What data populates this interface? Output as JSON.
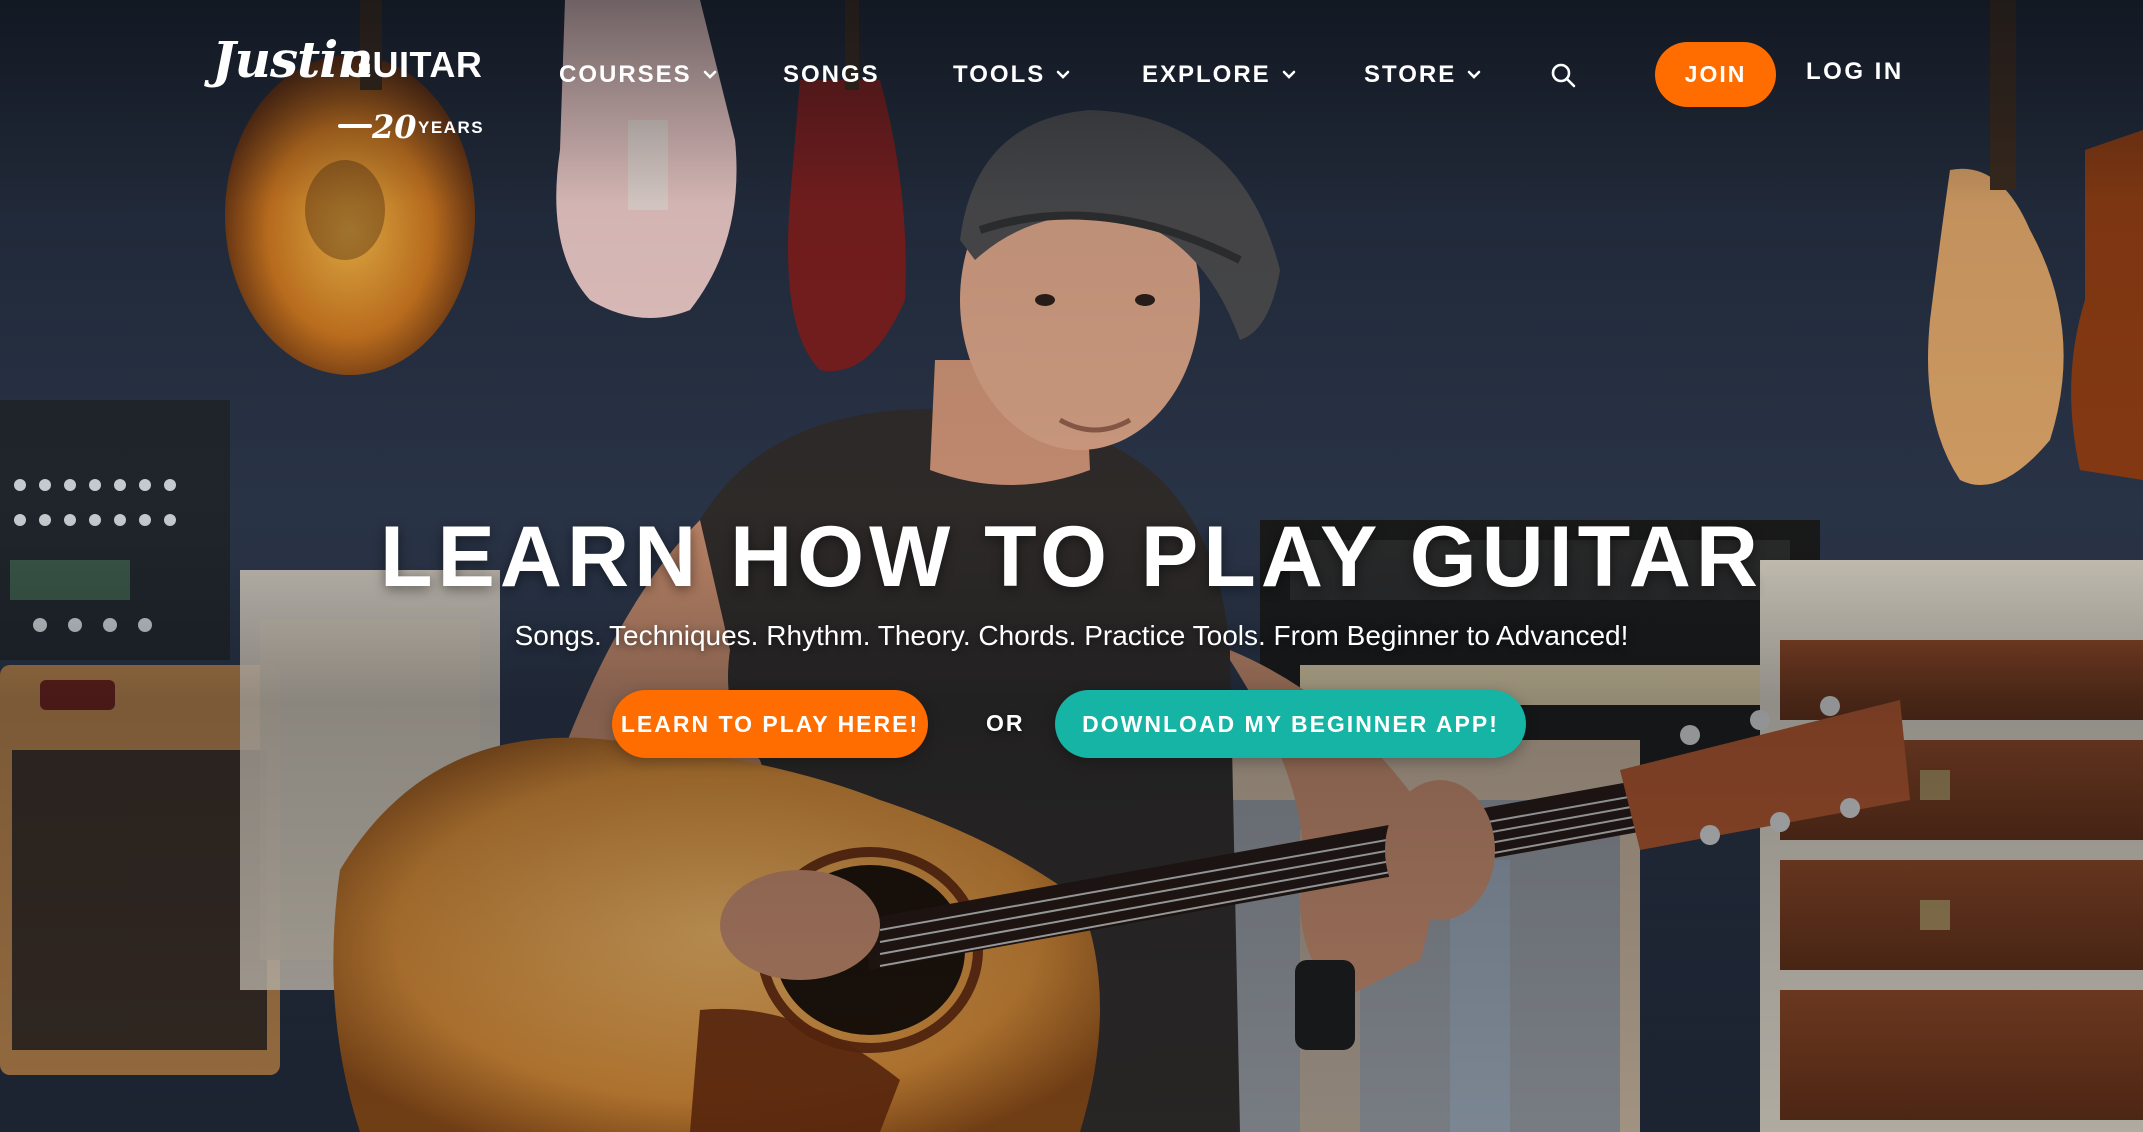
{
  "logo": {
    "script_text": "Justin",
    "brand_text": "GUITAR",
    "anniversary_number": "20",
    "anniversary_label": "YEARS"
  },
  "nav": {
    "items": [
      {
        "label": "COURSES",
        "has_dropdown": true
      },
      {
        "label": "SONGS",
        "has_dropdown": false
      },
      {
        "label": "TOOLS",
        "has_dropdown": true
      },
      {
        "label": "EXPLORE",
        "has_dropdown": true
      },
      {
        "label": "STORE",
        "has_dropdown": true
      }
    ],
    "search_icon": "search-icon",
    "join_label": "JOIN",
    "login_label": "LOG IN"
  },
  "hero": {
    "headline": "LEARN HOW TO PLAY GUITAR",
    "subhead": "Songs. Techniques. Rhythm. Theory. Chords. Practice Tools. From Beginner to Advanced!",
    "primary_cta": "LEARN TO PLAY HERE!",
    "separator": "OR",
    "secondary_cta": "DOWNLOAD MY BEGINNER APP!"
  },
  "colors": {
    "accent_orange": "#ff6d00",
    "accent_teal": "#16b4a4",
    "text": "#ffffff",
    "wall": "#2a3446"
  }
}
